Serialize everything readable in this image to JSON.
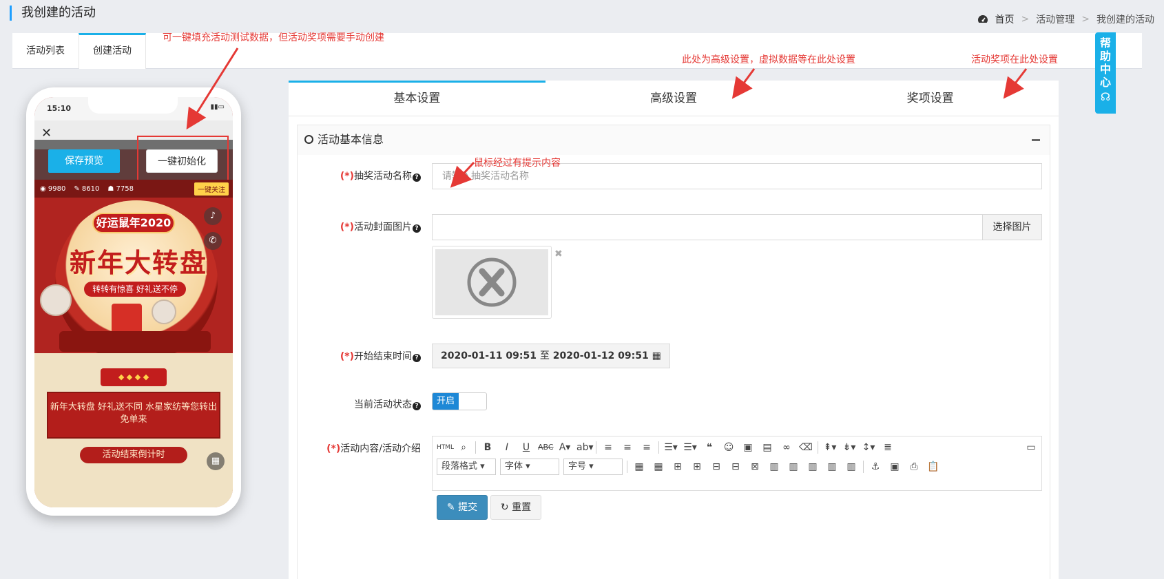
{
  "header": {
    "page_title": "我创建的活动",
    "breadcrumb": [
      "首页",
      "活动管理",
      "我创建的活动"
    ]
  },
  "top_tabs": [
    {
      "label": "活动列表",
      "active": false
    },
    {
      "label": "创建活动",
      "active": true
    }
  ],
  "phone": {
    "time": "15:10",
    "preview_button": "保存预览",
    "init_button": "一键初始化",
    "stats": [
      "9980",
      "8610",
      "7758"
    ],
    "follow_tag": "一键关注",
    "poster_tag": "好运鼠年2020",
    "poster_title": "新年大转盘",
    "poster_sub": "转转有惊喜 好礼送不停",
    "description": "新年大转盘 好礼送不同 水星家纺等您转出免单来",
    "countdown": "活动结束倒计时"
  },
  "settings_tabs": [
    {
      "label": "基本设置",
      "active": true
    },
    {
      "label": "高级设置",
      "active": false
    },
    {
      "label": "奖项设置",
      "active": false
    }
  ],
  "section_title": "活动基本信息",
  "form": {
    "name_label": "抽奖活动名称",
    "name_placeholder": "请输入抽奖活动名称",
    "cover_label": "活动封面图片",
    "choose_image": "选择图片",
    "time_label": "开始结束时间",
    "start_time": "2020-01-11 09:51",
    "range_sep": "至",
    "end_time": "2020-01-12 09:51",
    "status_label": "当前活动状态",
    "status_on": "开启",
    "content_label": "活动内容/活动介绍",
    "required_mark": "(*)",
    "editor_selects": [
      "段落格式",
      "字体",
      "字号"
    ],
    "submit": "提交",
    "reset": "重置"
  },
  "annotations": {
    "init_hint": "可一键填充活动测试数据，但活动奖项需要手动创建",
    "advanced_hint": "此处为高级设置，虚拟数据等在此处设置",
    "prize_hint": "活动奖项在此处设置",
    "hover_hint": "鼠标经过有提示内容"
  },
  "help_center": "帮助中心",
  "colors": {
    "accent": "#1ab0e8",
    "required": "#e53935",
    "submit": "#3c8dbc",
    "annotation": "#e53935"
  }
}
